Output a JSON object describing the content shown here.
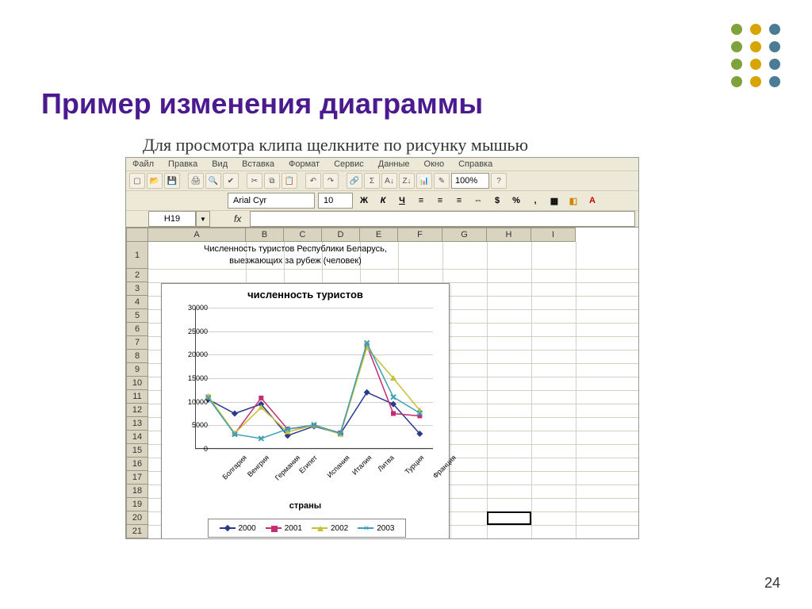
{
  "slide": {
    "title": "Пример изменения диаграммы",
    "subtitle": "Для просмотра клипа щелкните по рисунку мышью",
    "page": "24"
  },
  "dots": {
    "colors": [
      "#7fa23c",
      "#d8a400",
      "#4b7c96"
    ]
  },
  "excel": {
    "menu": [
      "Файл",
      "Правка",
      "Вид",
      "Вставка",
      "Формат",
      "Сервис",
      "Данные",
      "Окно",
      "Справка"
    ],
    "font": "Arial Cyr",
    "fontsize": "10",
    "zoom": "100%",
    "cellref": "H19",
    "columns": [
      "A",
      "B",
      "C",
      "D",
      "E",
      "F",
      "G",
      "H",
      "I"
    ],
    "rows": [
      "1",
      "2",
      "3",
      "4",
      "5",
      "6",
      "7",
      "8",
      "9",
      "10",
      "11",
      "12",
      "13",
      "14",
      "15",
      "16",
      "17",
      "18",
      "19",
      "20",
      "21"
    ],
    "a1_line1": "Численность туристов Республики Беларусь,",
    "a1_line2": "выезжающих за рубеж (человек)"
  },
  "chart_data": {
    "type": "line",
    "title": "численность туристов",
    "xlabel": "страны",
    "ylabel": "",
    "ylim": [
      0,
      30000
    ],
    "yticks": [
      0,
      5000,
      10000,
      15000,
      20000,
      25000,
      30000
    ],
    "categories": [
      "Болгария",
      "Венгрия",
      "Германия",
      "Египет",
      "Испания",
      "Италия",
      "Литва",
      "Турция",
      "Франция"
    ],
    "series": [
      {
        "name": "2000",
        "color": "#2a3a8a",
        "marker": "diamond",
        "values": [
          10500,
          7500,
          9500,
          2800,
          4800,
          3200,
          12000,
          9500,
          3200
        ]
      },
      {
        "name": "2001",
        "color": "#c22d74",
        "marker": "square",
        "values": [
          11000,
          3200,
          10800,
          4200,
          4900,
          3400,
          22000,
          7500,
          7000
        ]
      },
      {
        "name": "2002",
        "color": "#c8c037",
        "marker": "triangle",
        "values": [
          11200,
          3300,
          8800,
          3600,
          5000,
          3100,
          21500,
          15000,
          8200
        ]
      },
      {
        "name": "2003",
        "color": "#3da0b8",
        "marker": "x",
        "values": [
          10800,
          3100,
          2200,
          4200,
          5100,
          3300,
          22500,
          11000,
          7600
        ]
      }
    ],
    "legend_position": "bottom"
  }
}
